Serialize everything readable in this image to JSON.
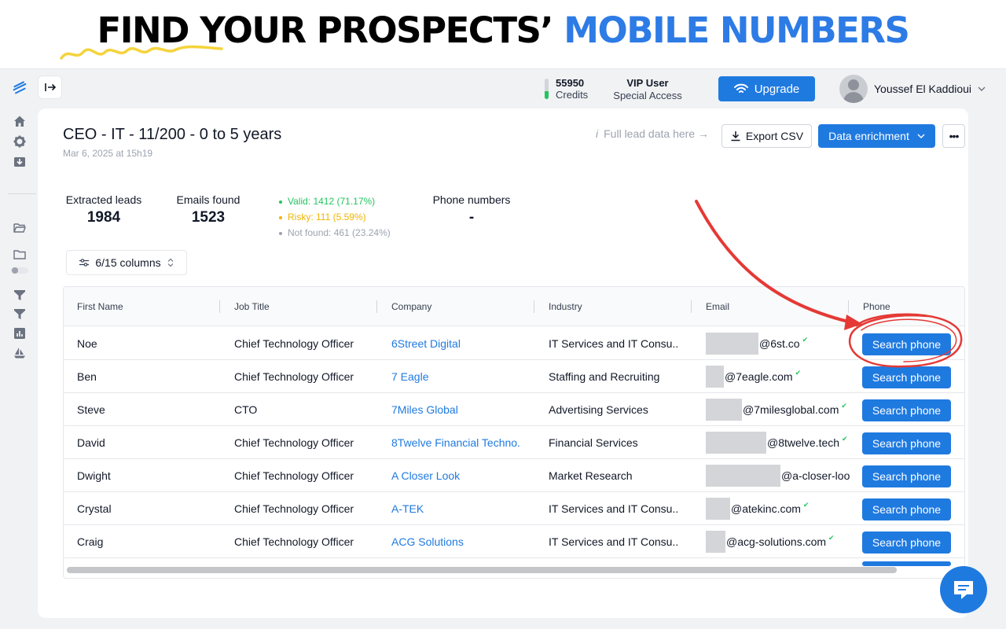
{
  "banner": {
    "headline_part1": "FIND YOUR PROSPECTS’ ",
    "headline_part2": "MOBILE NUMBERS"
  },
  "sidebar": {
    "icons": [
      "logo-icon",
      "home-icon",
      "gear-icon",
      "download-icon",
      "folder-open-icon",
      "folder-icon",
      "toggle-icon",
      "filter-icon",
      "filter-icon",
      "chart-icon",
      "boat-icon"
    ]
  },
  "header": {
    "credits_value": "55950",
    "credits_label": "Credits",
    "credits_fill": 0.4,
    "plan_title": "VIP User",
    "plan_subtitle": "Special Access",
    "upgrade_label": "Upgrade",
    "user_name": "Youssef El Kaddioui"
  },
  "list": {
    "title": "CEO - IT - 11/200 - 0 to 5 years",
    "date": "Mar 6, 2025 at 15h19",
    "info_icon": "i",
    "full_lead_text": "Full lead data here →",
    "export_label": "Export CSV",
    "enrich_label": "Data enrichment",
    "more_label": "•••"
  },
  "stats": {
    "extracted_label": "Extracted leads",
    "extracted_value": "1984",
    "emails_label": "Emails found",
    "emails_value": "1523",
    "valid": "Valid: 1412 (71.17%)",
    "risky": "Risky: 111 (5.59%)",
    "not_found": "Not found: 461 (23.24%)",
    "phone_label": "Phone numbers",
    "phone_value": "-",
    "valid_color": "#22c55e",
    "risky_color": "#f0b400",
    "not_found_color": "#9ca3af"
  },
  "columns_button": "6/15 columns",
  "table": {
    "headers": [
      "First Name",
      "Job Title",
      "Company",
      "Industry",
      "Email",
      "Phone"
    ],
    "search_label": "Search phone",
    "rows": [
      {
        "first": "Noe",
        "job": "Chief Technology Officer",
        "company": "6Street Digital",
        "industry": "IT Services and IT Consu..",
        "email": "@6st.co"
      },
      {
        "first": "Ben",
        "job": "Chief Technology Officer",
        "company": "7 Eagle",
        "industry": "Staffing and Recruiting",
        "email": "@7eagle.com"
      },
      {
        "first": "Steve",
        "job": "CTO",
        "company": "7Miles Global",
        "industry": "Advertising Services",
        "email": "@7milesglobal.com"
      },
      {
        "first": "David",
        "job": "Chief Technology Officer",
        "company": "8Twelve Financial Techno.",
        "industry": "Financial Services",
        "email": "@8twelve.tech"
      },
      {
        "first": "Dwight",
        "job": "Chief Technology Officer",
        "company": "A Closer Look",
        "industry": "Market Research",
        "email": "@a-closer-loo"
      },
      {
        "first": "Crystal",
        "job": "Chief Technology Officer",
        "company": "A-TEK",
        "industry": "IT Services and IT Consu..",
        "email": "@atekinc.com"
      },
      {
        "first": "Craig",
        "job": "Chief Technology Officer",
        "company": "ACG Solutions",
        "industry": "IT Services and IT Consu..",
        "email": "@acg-solutions.com"
      }
    ]
  },
  "colors": {
    "accent": "#1f7ae0",
    "annotation": "#e53935",
    "squiggle": "#f5d33b"
  }
}
